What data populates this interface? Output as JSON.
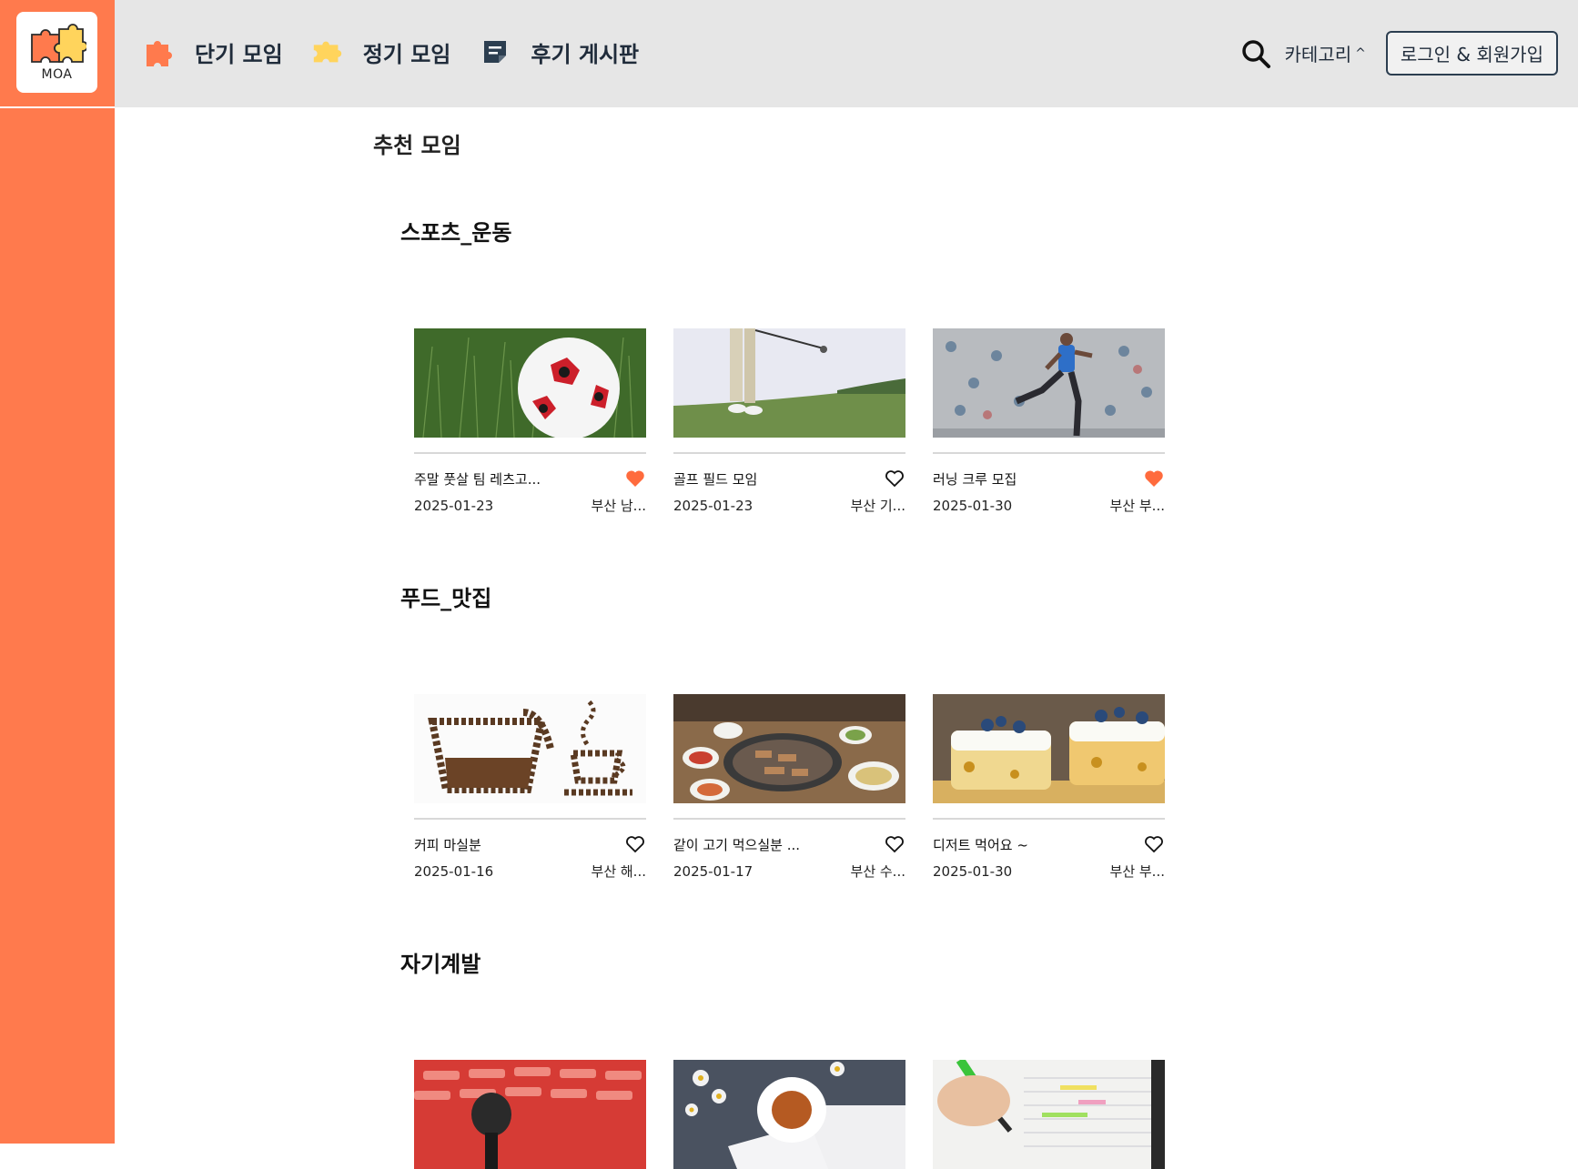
{
  "logo": {
    "text": "MOA"
  },
  "nav": {
    "items": [
      {
        "label": "단기 모임",
        "icon": "puzzle-piece-icon",
        "color": "#ff7a4d"
      },
      {
        "label": "정기 모임",
        "icon": "puzzle-piece-icon",
        "color": "#ffd45c"
      },
      {
        "label": "후기 게시판",
        "icon": "note-icon",
        "color": "#2c3e50"
      }
    ]
  },
  "header": {
    "search_icon": "search-icon",
    "category_label": "카테고리",
    "category_caret": "^",
    "login_label": "로그인 & 회원가입"
  },
  "main": {
    "page_title": "추천 모임",
    "sections": [
      {
        "title": "스포츠_운동",
        "cards": [
          {
            "name": "주말 풋살 팀 레츠고...",
            "date": "2025-01-23",
            "location": "부산 남...",
            "liked": true,
            "image": "soccer-ball-on-grass"
          },
          {
            "name": "골프 필드 모임",
            "date": "2025-01-23",
            "location": "부산 기...",
            "liked": false,
            "image": "golf-swing"
          },
          {
            "name": "러닝 크루 모집",
            "date": "2025-01-30",
            "location": "부산 부...",
            "liked": true,
            "image": "runner-by-wall"
          }
        ]
      },
      {
        "title": "푸드_맛집",
        "cards": [
          {
            "name": "커피 마실분",
            "date": "2025-01-16",
            "location": "부산 해...",
            "liked": false,
            "image": "coffee-bean-pot"
          },
          {
            "name": "같이 고기 먹으실분 ...",
            "date": "2025-01-17",
            "location": "부산 수...",
            "liked": false,
            "image": "korean-bbq-table"
          },
          {
            "name": "디저트 먹어요 ~",
            "date": "2025-01-30",
            "location": "부산 부...",
            "liked": false,
            "image": "blueberry-cake"
          }
        ]
      },
      {
        "title": "자기계발",
        "cards": [
          {
            "image": "microphone-red-seats"
          },
          {
            "image": "tea-cup-flowers"
          },
          {
            "image": "highlighter-notebook"
          }
        ]
      }
    ]
  },
  "colors": {
    "sidebar": "#ff7a4d",
    "topbar": "#e6e6e6",
    "heart_liked": "#ff6b3d",
    "nav_text": "#1f2b3a"
  }
}
